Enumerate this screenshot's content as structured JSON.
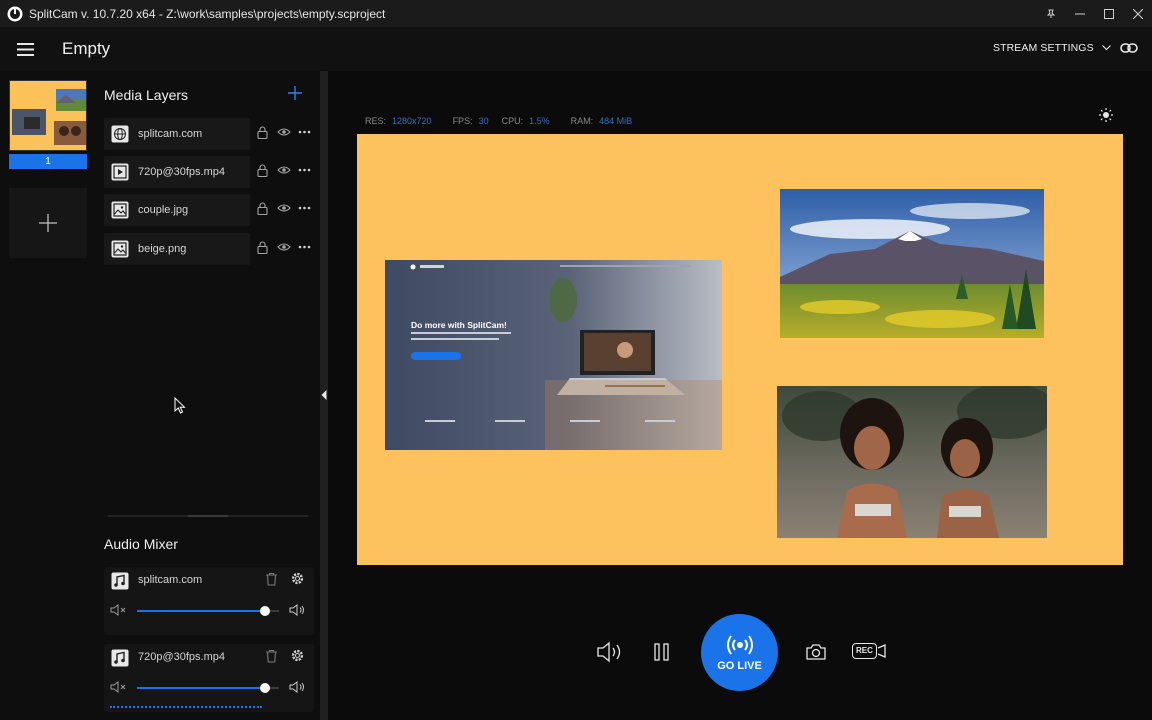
{
  "titlebar": {
    "title": "SplitCam v. 10.7.20 x64 - Z:\\work\\samples\\projects\\empty.scproject"
  },
  "header": {
    "project_name": "Empty",
    "stream_settings_label": "STREAM SETTINGS"
  },
  "scenes": {
    "items": [
      {
        "number": "1"
      }
    ]
  },
  "media_layers": {
    "title": "Media Layers",
    "items": [
      {
        "name": "splitcam.com",
        "icon": "globe-icon"
      },
      {
        "name": "720p@30fps.mp4",
        "icon": "video-file-icon"
      },
      {
        "name": "couple.jpg",
        "icon": "image-file-icon"
      },
      {
        "name": "beige.png",
        "icon": "image-file-icon"
      }
    ]
  },
  "audio_mixer": {
    "title": "Audio Mixer",
    "items": [
      {
        "name": "splitcam.com",
        "volume": 0.9
      },
      {
        "name": "720p@30fps.mp4",
        "volume": 0.9
      }
    ]
  },
  "stats": {
    "res_label": "RES:",
    "res_value": "1280x720",
    "fps_label": "FPS:",
    "fps_value": "30",
    "cpu_label": "CPU:",
    "cpu_value": "1.5%",
    "ram_label": "RAM:",
    "ram_value": "484 MiB"
  },
  "website_preview": {
    "headline": "Do more with SplitCam!"
  },
  "controls": {
    "go_live_label": "GO LIVE",
    "rec_label": "REC"
  },
  "colors": {
    "accent": "#1a73e8",
    "canvas_background": "#fdc25d",
    "panel": "#151515"
  }
}
